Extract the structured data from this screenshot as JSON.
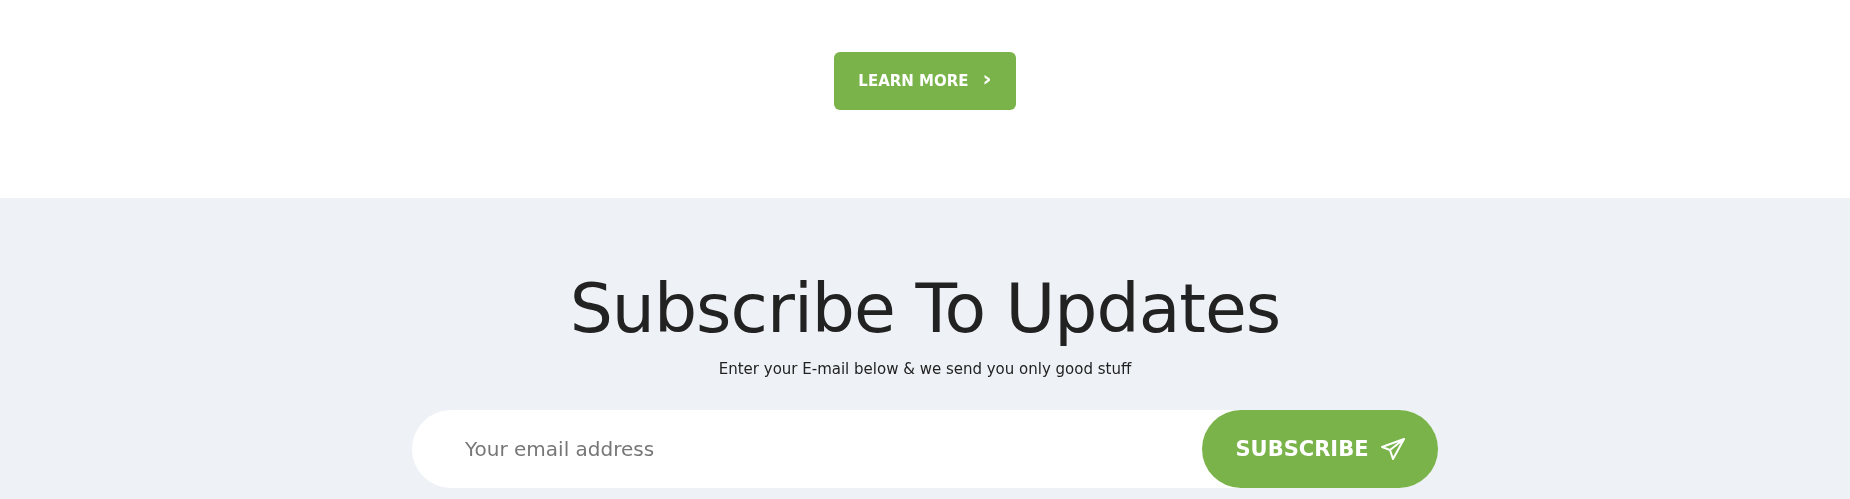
{
  "cta": {
    "label": "LEARN MORE",
    "icon": "›"
  },
  "subscribe": {
    "title": "Subscribe To Updates",
    "subtitle": "Enter your E-mail below & we send you only good stuff",
    "email": {
      "placeholder": "Your email address"
    },
    "button": {
      "label": "SUBSCRIBE"
    }
  }
}
